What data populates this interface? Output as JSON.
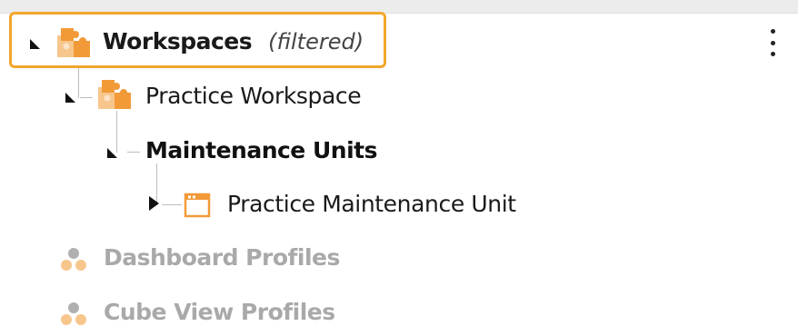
{
  "tree": {
    "workspaces": {
      "label": "Workspaces",
      "filter_note": "(filtered)",
      "expanded": true,
      "icon": "puzzle-icon",
      "highlight_color": "#f2a72b"
    },
    "practice_workspace": {
      "label": "Practice Workspace",
      "expanded": true,
      "icon": "puzzle-icon"
    },
    "maintenance_units": {
      "label": "Maintenance Units",
      "expanded": true
    },
    "practice_maintenance_unit": {
      "label": "Practice Maintenance Unit",
      "expanded": false,
      "icon": "window-icon"
    },
    "dashboard_profiles": {
      "label": "Dashboard Profiles",
      "icon": "dots-cluster-icon"
    },
    "cube_view_profiles": {
      "label": "Cube View Profiles",
      "icon": "dots-cluster-icon"
    }
  },
  "menu": {
    "icon": "kebab-menu-icon"
  },
  "colors": {
    "accent_orange": "#f2a72b",
    "icon_orange": "#f29a38",
    "icon_light_orange": "#f7c68c",
    "disabled_text": "#a9a9a9"
  }
}
